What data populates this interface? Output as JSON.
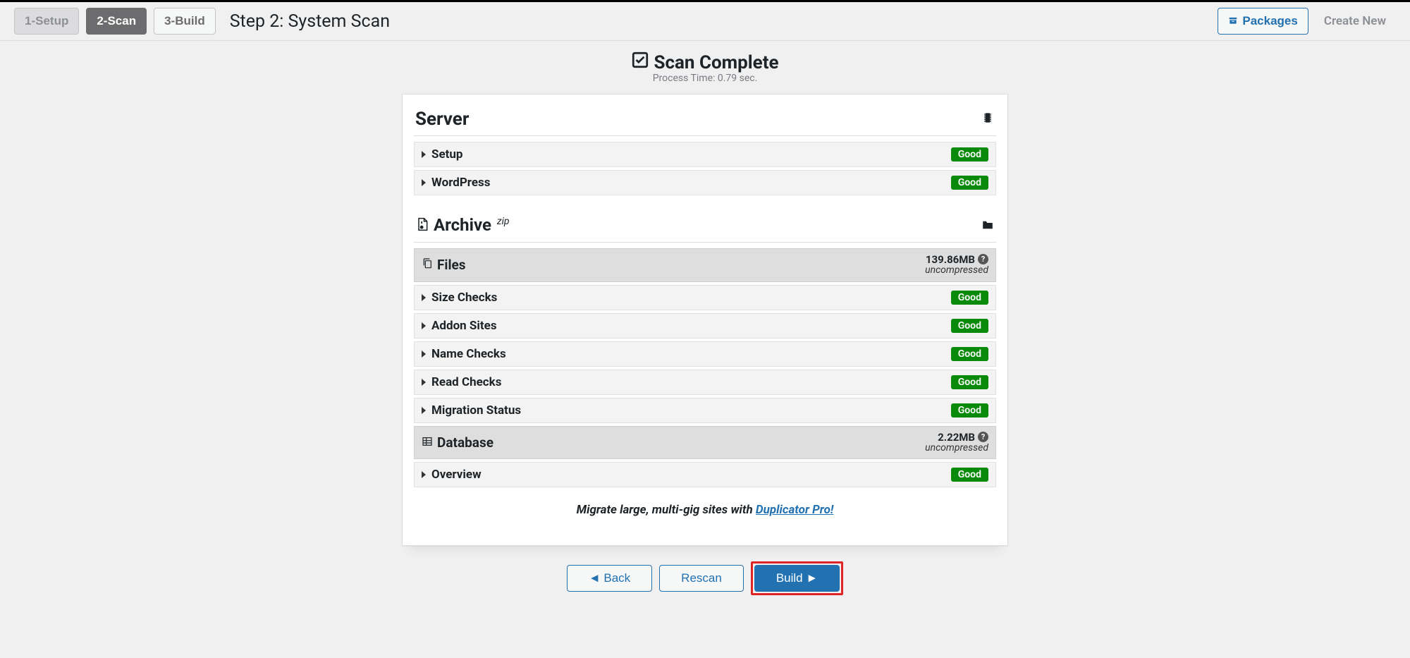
{
  "header": {
    "steps": [
      "1-Setup",
      "2-Scan",
      "3-Build"
    ],
    "step_title": "Step 2: System Scan",
    "packages_btn": "Packages",
    "create_new": "Create New"
  },
  "scan": {
    "title": "Scan Complete",
    "process_time": "Process Time: 0.79 sec."
  },
  "server": {
    "heading": "Server",
    "rows": [
      {
        "label": "Setup",
        "status": "Good"
      },
      {
        "label": "WordPress",
        "status": "Good"
      }
    ]
  },
  "archive": {
    "heading": "Archive",
    "zip_label": "zip",
    "files": {
      "label": "Files",
      "size": "139.86MB",
      "uncompressed": "uncompressed",
      "rows": [
        {
          "label": "Size Checks",
          "status": "Good"
        },
        {
          "label": "Addon Sites",
          "status": "Good"
        },
        {
          "label": "Name Checks",
          "status": "Good"
        },
        {
          "label": "Read Checks",
          "status": "Good"
        },
        {
          "label": "Migration Status",
          "status": "Good"
        }
      ]
    },
    "database": {
      "label": "Database",
      "size": "2.22MB",
      "uncompressed": "uncompressed",
      "rows": [
        {
          "label": "Overview",
          "status": "Good"
        }
      ]
    }
  },
  "promo": {
    "text": "Migrate large, multi-gig sites with ",
    "link_text": "Duplicator Pro!"
  },
  "buttons": {
    "back": "◄ Back",
    "rescan": "Rescan",
    "build": "Build ►"
  }
}
